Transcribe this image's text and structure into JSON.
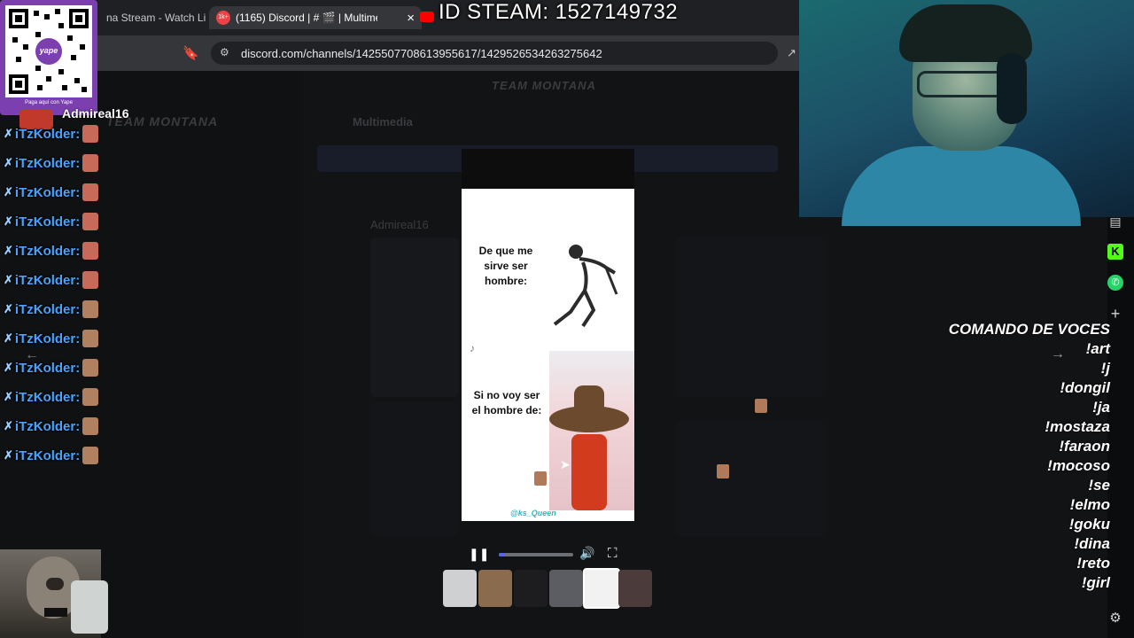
{
  "browser": {
    "tabs": [
      {
        "label": "na Stream - Watch Li",
        "active": false
      },
      {
        "label": "(1165) Discord | # 🎬 | Multimedi",
        "active": true
      },
      {
        "label": "",
        "active": false
      }
    ],
    "tab_badge": "1k+",
    "close_glyph": "×",
    "url": "discord.com/channels/1425507708613955617/1429526534263275642"
  },
  "overlay": {
    "steam_id": "ID STEAM: 1527149732"
  },
  "qr": {
    "brand": "yape",
    "caption": "Paga aquí con Yape"
  },
  "discord": {
    "server_name": "TEAM MONTANA",
    "channel_title": "Multimedia",
    "top_banner": "TEAM MONTANA",
    "author": "Admireal16"
  },
  "chat": {
    "header_user": "Admireal16",
    "messages": [
      {
        "user": "iTzKolder:",
        "emote": "red"
      },
      {
        "user": "iTzKolder:",
        "emote": "red"
      },
      {
        "user": "iTzKolder:",
        "emote": "red"
      },
      {
        "user": "iTzKolder:",
        "emote": "red"
      },
      {
        "user": "iTzKolder:",
        "emote": "red"
      },
      {
        "user": "iTzKolder:",
        "emote": "red"
      },
      {
        "user": "iTzKolder:",
        "emote": "face"
      },
      {
        "user": "iTzKolder:",
        "emote": "face"
      },
      {
        "user": "iTzKolder:",
        "emote": "face"
      },
      {
        "user": "iTzKolder:",
        "emote": "face"
      },
      {
        "user": "iTzKolder:",
        "emote": "face"
      },
      {
        "user": "iTzKolder:",
        "emote": "face"
      }
    ]
  },
  "video": {
    "top_text": "De que me sirve ser hombre:",
    "bottom_text": "Si no voy ser el hombre de:",
    "watermark": "@ks_Queen"
  },
  "commands": {
    "title": "COMANDO DE VOCES",
    "items": [
      "!art",
      "!j",
      "!dongil",
      "!ja",
      "!mostaza",
      "!faraon",
      "!mocoso",
      "!se",
      "!elmo",
      "!goku",
      "!dina",
      "!reto",
      "!girl"
    ]
  },
  "colors": {
    "chat_name": "#4aa3ff",
    "qr_frame": "#7b3fb0",
    "kick_green": "#53fc18",
    "whatsapp_green": "#25d366"
  }
}
